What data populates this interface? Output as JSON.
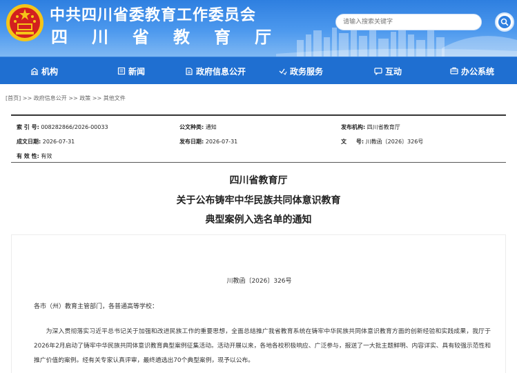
{
  "header": {
    "org_name": "中共四川省委教育工作委员会",
    "dept_name": "四川省教育厅",
    "search_placeholder": "请输入搜索关键字"
  },
  "nav": {
    "items": [
      {
        "label": "机构",
        "icon": "building-icon"
      },
      {
        "label": "新闻",
        "icon": "news-icon"
      },
      {
        "label": "政府信息公开",
        "icon": "document-icon"
      },
      {
        "label": "政务服务",
        "icon": "service-icon"
      },
      {
        "label": "互动",
        "icon": "chat-icon"
      },
      {
        "label": "办公系统",
        "icon": "office-icon"
      }
    ]
  },
  "breadcrumb": {
    "items": [
      "[首页]",
      "政府信息公开",
      "政策",
      "其他文件"
    ],
    "separator": ">>"
  },
  "meta": {
    "index_label": "索 引 号:",
    "index_value": "008282866/2026-00033",
    "doc_type_label": "公文种类:",
    "doc_type_value": "通知",
    "issuer_label": "发布机构:",
    "issuer_value": "四川省教育厅",
    "created_label": "成文日期:",
    "created_value": "2026-07-31",
    "published_label": "发布日期:",
    "published_value": "2026-07-31",
    "docnum_label": "文     号:",
    "docnum_value": "川教函〔2026〕326号",
    "validity_label": "有 效 性:",
    "validity_value": "有效"
  },
  "article": {
    "title_line1": "四川省教育厅",
    "title_line2": "关于公布铸牢中华民族共同体意识教育",
    "title_line3": "典型案例入选名单的通知",
    "doc_number": "川教函〔2026〕326号",
    "addressee": "各市（州）教育主管部门，各普通高等学校：",
    "paragraph1": "为深入贯彻落实习近平总书记关于加强和改进民族工作的重要思想，全面总结推广我省教育系统在铸牢中华民族共同体意识教育方面的创新经验和实践成果，我厅于2026年2月启动了铸牢中华民族共同体意识教育典型案例征集活动。活动开展以来，各地各校积极响应、广泛参与，报送了一大批主题鲜明、内容详实、具有较强示范性和推广价值的案例。经有关专家认真评审，最终遴选出70个典型案例，现予以公布。"
  },
  "colors": {
    "nav_bg": "#1f6fd1",
    "banner_top": "#2e7fe0",
    "emblem_red": "#d3201f",
    "emblem_gold": "#f5c518"
  }
}
